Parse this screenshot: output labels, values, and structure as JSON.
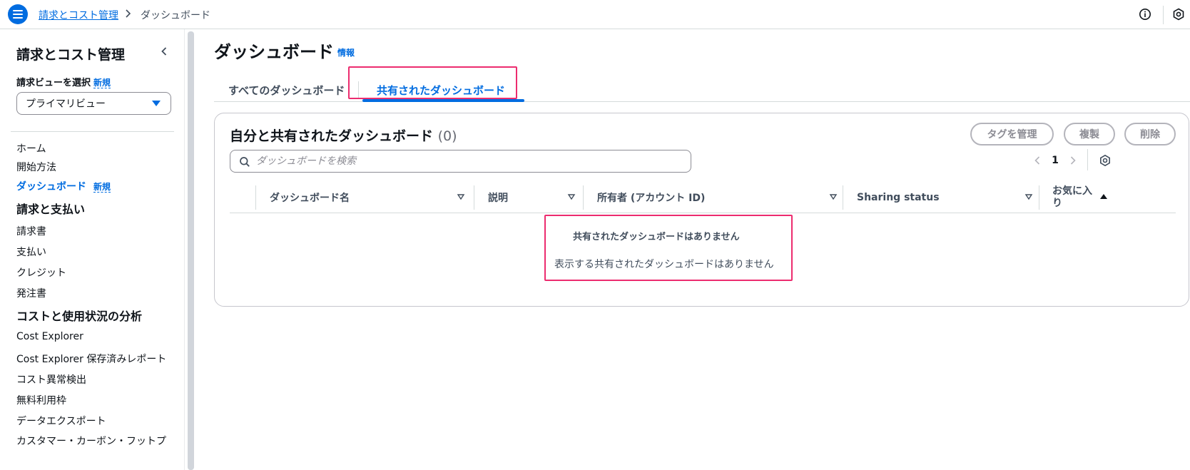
{
  "topbar": {
    "breadcrumb_link": "請求とコスト管理",
    "breadcrumb_current": "ダッシュボード"
  },
  "sidebar": {
    "title": "請求とコスト管理",
    "view_label": "請求ビューを選択",
    "new_badge": "新規",
    "view_selected": "プライマリビュー",
    "items": [
      {
        "label": "ホーム"
      },
      {
        "label": "開始方法"
      },
      {
        "label": "ダッシュボード",
        "badge": "新規"
      }
    ],
    "section_billing": "請求と支払い",
    "billing_items": [
      {
        "label": "請求書"
      },
      {
        "label": "支払い"
      },
      {
        "label": "クレジット"
      },
      {
        "label": "発注書"
      }
    ],
    "section_analysis": "コストと使用状況の分析",
    "analysis_items": [
      {
        "label": "Cost Explorer"
      },
      {
        "label": "Cost Explorer 保存済みレポート"
      },
      {
        "label": "コスト異常検出"
      },
      {
        "label": "無料利用枠"
      },
      {
        "label": "データエクスポート"
      },
      {
        "label": "カスタマー・カーボン・フットプ"
      }
    ]
  },
  "main": {
    "title": "ダッシュボード",
    "info_link": "情報",
    "tabs": [
      {
        "label": "すべてのダッシュボード"
      },
      {
        "label": "共有されたダッシュボード"
      }
    ],
    "panel": {
      "title": "自分と共有されたダッシュボード",
      "count": "(0)",
      "buttons": {
        "manage_tags": "タグを管理",
        "copy": "複製",
        "delete": "削除"
      },
      "search_placeholder": "ダッシュボードを検索",
      "page_number": "1",
      "columns": [
        {
          "label": "ダッシュボード名"
        },
        {
          "label": "説明"
        },
        {
          "label": "所有者 (アカウント ID)"
        },
        {
          "label": "Sharing status"
        },
        {
          "label": "お気に入り"
        }
      ],
      "empty_title": "共有されたダッシュボードはありません",
      "empty_description": "表示する共有されたダッシュボードはありません"
    }
  },
  "colors": {
    "accent": "#006ce0",
    "highlight": "#ec2c6f",
    "text": "#0f141a",
    "muted": "#414d5c",
    "border": "#d5dbdb"
  }
}
